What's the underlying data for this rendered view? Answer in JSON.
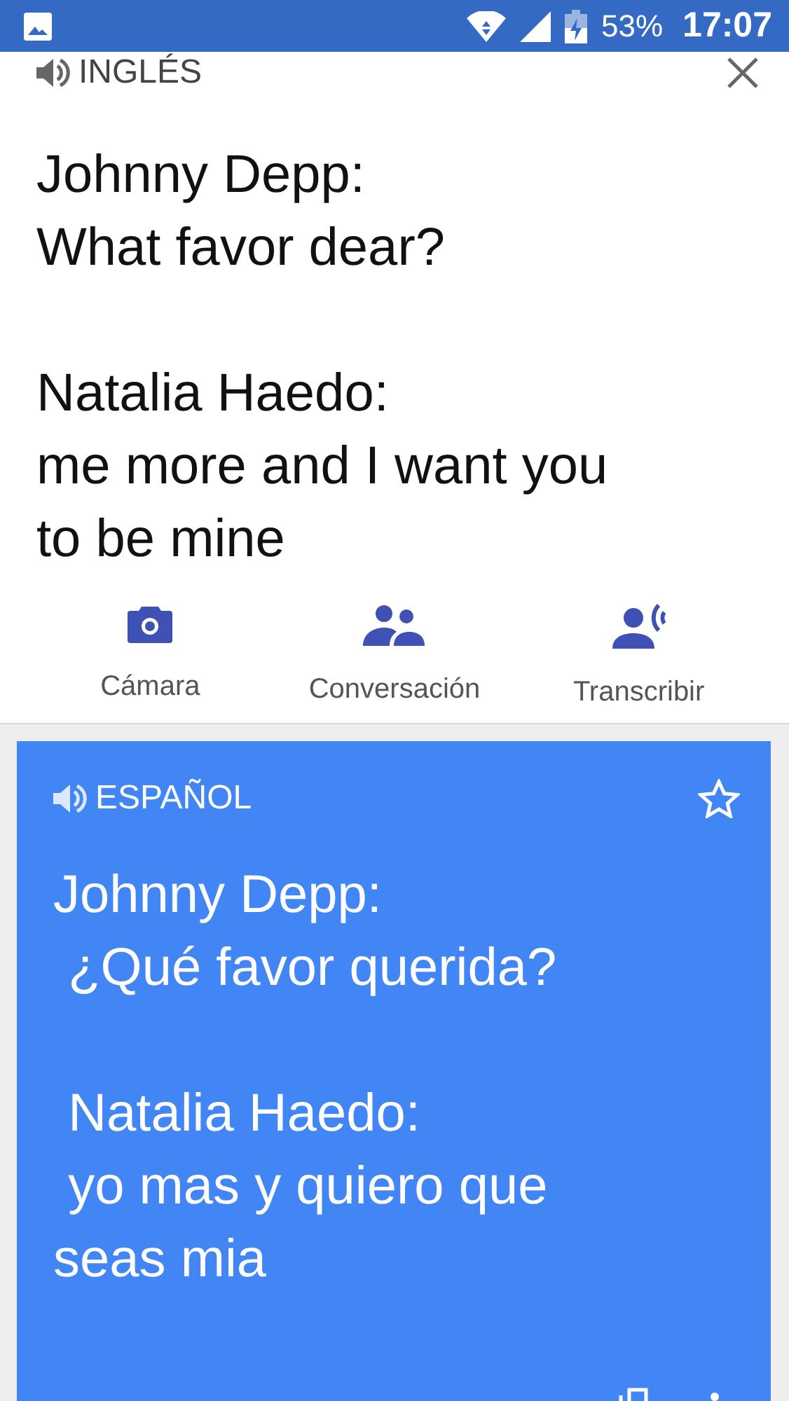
{
  "status_bar": {
    "battery": "53%",
    "time": "17:07"
  },
  "source": {
    "language": "INGLÉS",
    "text": "Johnny Depp:\nWhat favor dear?\n\nNatalia Haedo:\nme more and I want you\nto be mine"
  },
  "actions": [
    {
      "kind": "camera",
      "label": "Cámara"
    },
    {
      "kind": "conversation",
      "label": "Conversación"
    },
    {
      "kind": "transcribe",
      "label": "Transcribir"
    }
  ],
  "translation": {
    "language": "ESPAÑOL",
    "starred": false,
    "text": "Johnny Depp:\n ¿Qué favor querida?\n\n Natalia Haedo:\n yo mas y quiero que\nseas mia"
  }
}
